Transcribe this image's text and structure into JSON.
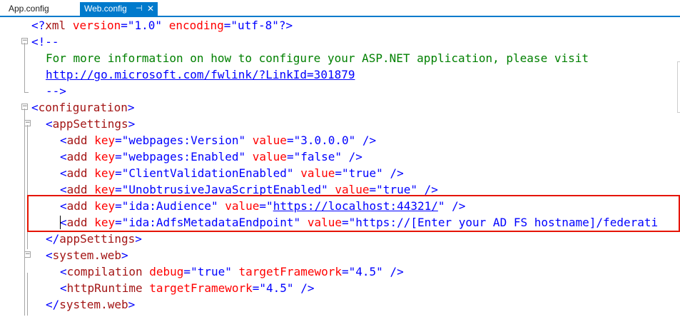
{
  "tabs": {
    "inactive_label": "App.config",
    "active_label": "Web.config",
    "pin_glyph": "⊣",
    "close_glyph": "✕"
  },
  "colors": {
    "accent": "#007acc",
    "highlight_border": "#e51400",
    "xml_delimiter": "#0000ff",
    "xml_tag": "#a31515",
    "xml_attribute": "#ff0000",
    "xml_value": "#0000ff",
    "comment": "#008000"
  },
  "code": {
    "l1_open": "<?",
    "l1_tag": "xml",
    "l1_a1": "version",
    "l1_v1": "\"1.0\"",
    "l1_a2": "encoding",
    "l1_v2": "\"utf-8\"",
    "l1_close": "?>",
    "l2_open": "<!--",
    "l3_comment": "For more information on how to configure your ASP.NET application, please visit",
    "l4_link": "http://go.microsoft.com/fwlink/?LinkId=301879",
    "l5_close": "-->",
    "l6_tag": "configuration",
    "l7_tag": "appSettings",
    "add_tag": "add",
    "key_attr": "key",
    "value_attr": "value",
    "settings": [
      {
        "key": "\"webpages:Version\"",
        "value": "\"3.0.0.0\""
      },
      {
        "key": "\"webpages:Enabled\"",
        "value": "\"false\""
      },
      {
        "key": "\"ClientValidationEnabled\"",
        "value": "\"true\""
      },
      {
        "key": "\"UnobtrusiveJavaScriptEnabled\"",
        "value": "\"true\""
      },
      {
        "key": "\"ida:Audience\"",
        "value_open": "\"",
        "value_link": "https://localhost:44321/",
        "value_close": "\""
      },
      {
        "key": "\"ida:AdfsMetadataEndpoint\"",
        "value": "\"https://[Enter your AD FS hostname]/federati"
      }
    ],
    "l14_tag": "appSettings",
    "l15_tag": "system.web",
    "l16_tag": "compilation",
    "l16_a1": "debug",
    "l16_v1": "\"true\"",
    "l16_a2": "targetFramework",
    "l16_v2": "\"4.5\"",
    "l17_tag": "httpRuntime",
    "l17_a1": "targetFramework",
    "l17_v1": "\"4.5\"",
    "l18_tag": "system.web",
    "fold_minus": "−"
  }
}
